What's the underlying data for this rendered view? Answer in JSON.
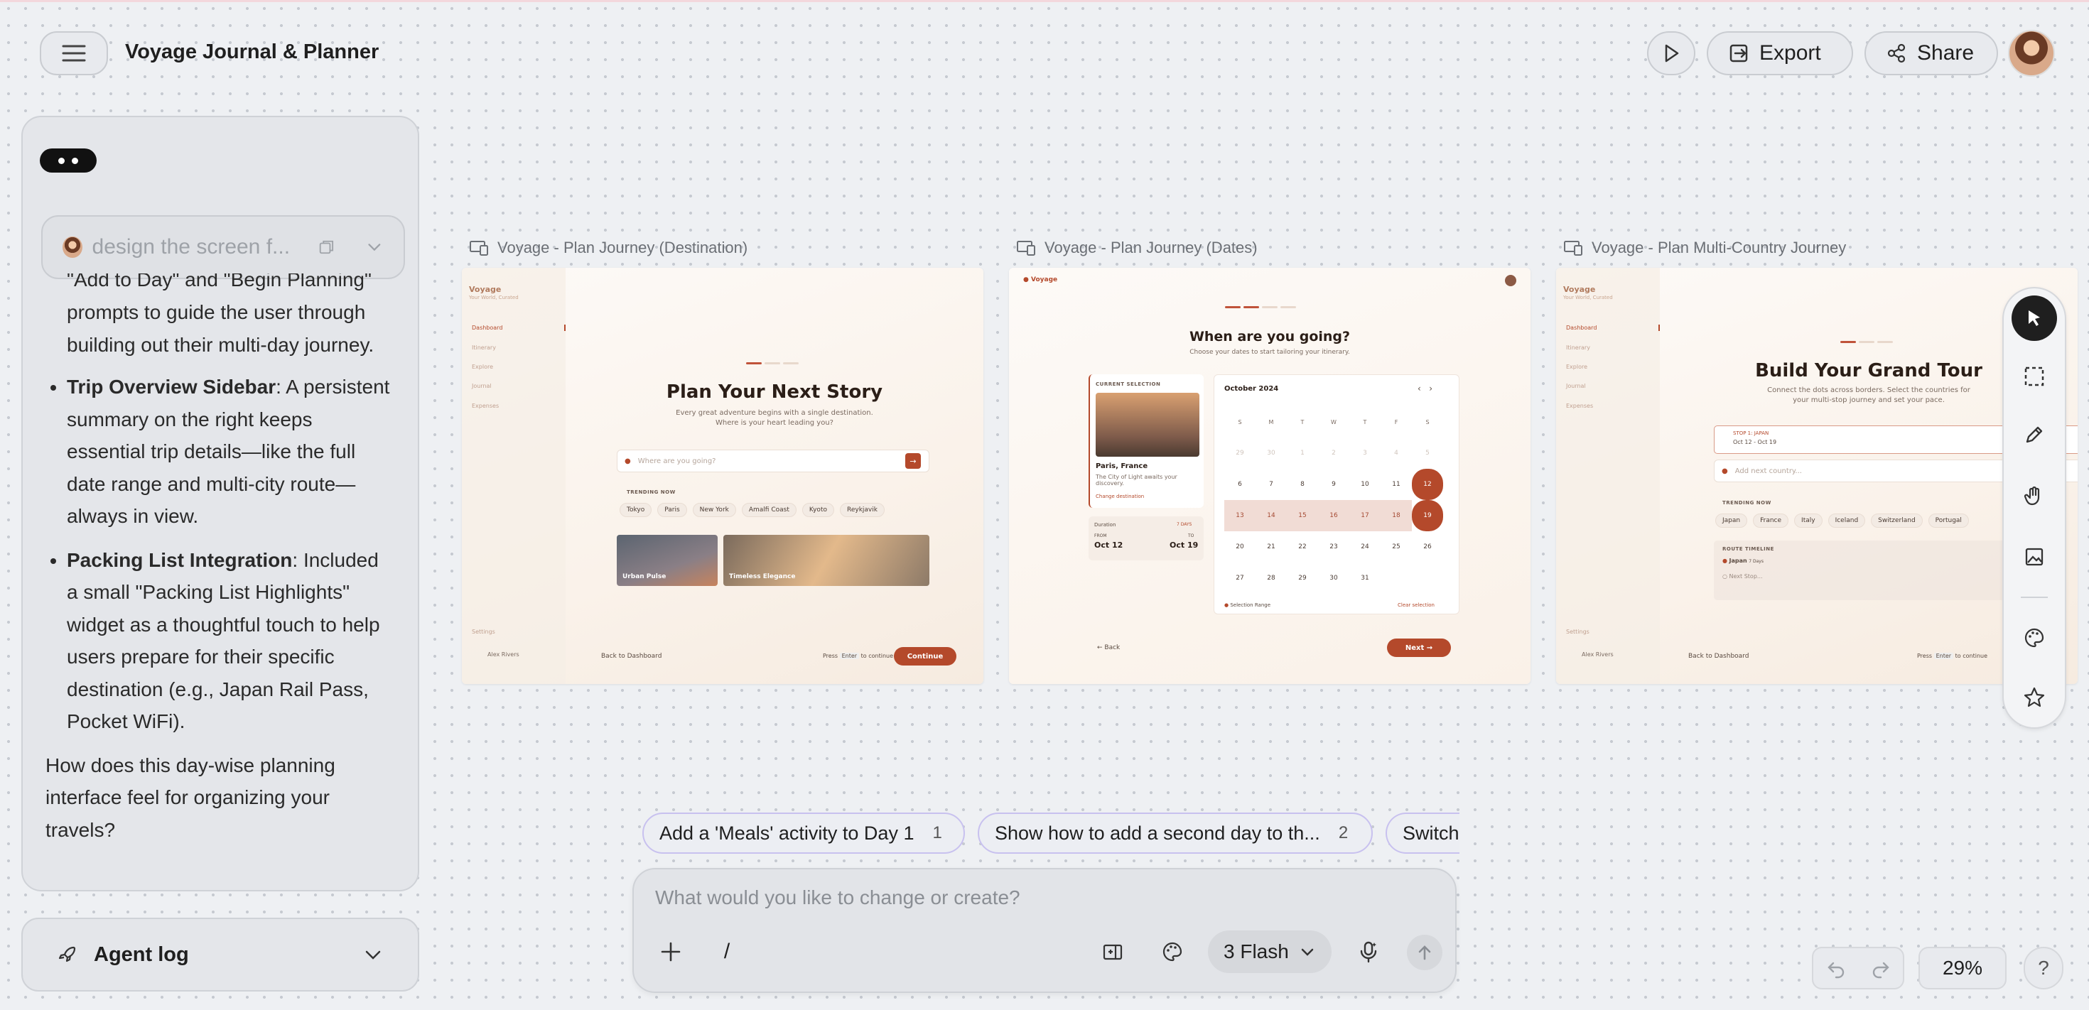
{
  "app": {
    "title": "Voyage Journal & Planner"
  },
  "header": {
    "export_label": "Export",
    "share_label": "Share"
  },
  "chat": {
    "prompt_preview": "design the screen f...",
    "partial_line": "\"Add to Day\" and \"Begin Planning\"",
    "intro_rest": "prompts to guide the user through building out their multi-day journey.",
    "bullets": [
      {
        "title": "Trip Overview Sidebar",
        "text": ": A persistent summary on the right keeps essential trip details—like the full date range and multi-city route—always in view."
      },
      {
        "title": "Packing List Integration",
        "text": ": Included a small \"Packing List Highlights\" widget as a thoughtful touch to help users prepare for their specific destination (e.g., Japan Rail Pass, Pocket WiFi)."
      }
    ],
    "closing": "How does this day-wise planning interface feel for organizing your travels?",
    "agent_log_label": "Agent log"
  },
  "frames": [
    {
      "label": "Voyage - Plan Journey (Destination)",
      "logo": "Voyage",
      "tagline": "Your World, Curated",
      "nav": [
        "Dashboard",
        "Itinerary",
        "Explore",
        "Journal",
        "Expenses"
      ],
      "settings": "Settings",
      "user": "Alex Rivers",
      "heading": "Plan Your Next Story",
      "subtext": "Every great adventure begins with a single destination.\nWhere is your heart leading you?",
      "search_placeholder": "Where are you going?",
      "trending_label": "TRENDING NOW",
      "trending": [
        "Tokyo",
        "Paris",
        "New York",
        "Amalfi Coast",
        "Kyoto",
        "Reykjavik"
      ],
      "cards": [
        "Urban Pulse",
        "Timeless Elegance"
      ],
      "back": "Back to Dashboard",
      "press_pre": "Press",
      "press_key": "Enter",
      "press_post": "to continue",
      "continue": "Continue"
    },
    {
      "label": "Voyage - Plan Journey (Dates)",
      "logo": "Voyage",
      "heading": "When are you going?",
      "subtext": "Choose your dates to start tailoring your itinerary.",
      "current_selection": "CURRENT SELECTION",
      "place": "Paris, France",
      "place_desc": "The City of Light awaits your discovery.",
      "change_dest": "Change destination",
      "duration_label": "Duration",
      "duration_badge": "7 DAYS",
      "from_label": "FROM",
      "from": "Oct 12",
      "to_label": "TO",
      "to": "Oct 19",
      "month": "October 2024",
      "weekdays": [
        "S",
        "M",
        "T",
        "W",
        "T",
        "F",
        "S"
      ],
      "selection_range": "Selection Range",
      "clear": "Clear selection",
      "back": "Back",
      "next": "Next"
    },
    {
      "label": "Voyage - Plan Multi-Country Journey",
      "logo": "Voyage",
      "tagline": "Your World, Curated",
      "nav": [
        "Dashboard",
        "Itinerary",
        "Explore",
        "Journal",
        "Expenses"
      ],
      "settings": "Settings",
      "user": "Alex Rivers",
      "heading": "Build Your Grand Tour",
      "subtext": "Connect the dots across borders. Select the countries for\nyour multi-stop journey and set your pace.",
      "stop_label": "STOP 1: JAPAN",
      "stop_dates": "Oct 12 - Oct 19",
      "add_placeholder": "Add next country...",
      "trending_label": "TRENDING NOW",
      "trending": [
        "Japan",
        "France",
        "Italy",
        "Iceland",
        "Switzerland",
        "Portugal"
      ],
      "timeline_label": "ROUTE TIMELINE",
      "timeline": [
        {
          "name": "Japan",
          "days": "7 Days"
        },
        {
          "name": "Next Stop...",
          "days": ""
        }
      ],
      "back": "Back to Dashboard",
      "press_pre": "Press",
      "press_key": "Enter",
      "press_post": "to continue"
    }
  ],
  "suggestions": [
    {
      "text": "Add a 'Meals' activity to Day 1",
      "num": "1"
    },
    {
      "text": "Show how to add a second day to th...",
      "num": "2"
    },
    {
      "text": "Switch",
      "num": ""
    }
  ],
  "composer": {
    "placeholder": "What would you like to change or create?",
    "slash": "/",
    "model": "3 Flash"
  },
  "zoom": "29%",
  "help": "?",
  "tools": [
    "select",
    "marquee",
    "pencil",
    "hand",
    "image",
    "palette",
    "star"
  ]
}
